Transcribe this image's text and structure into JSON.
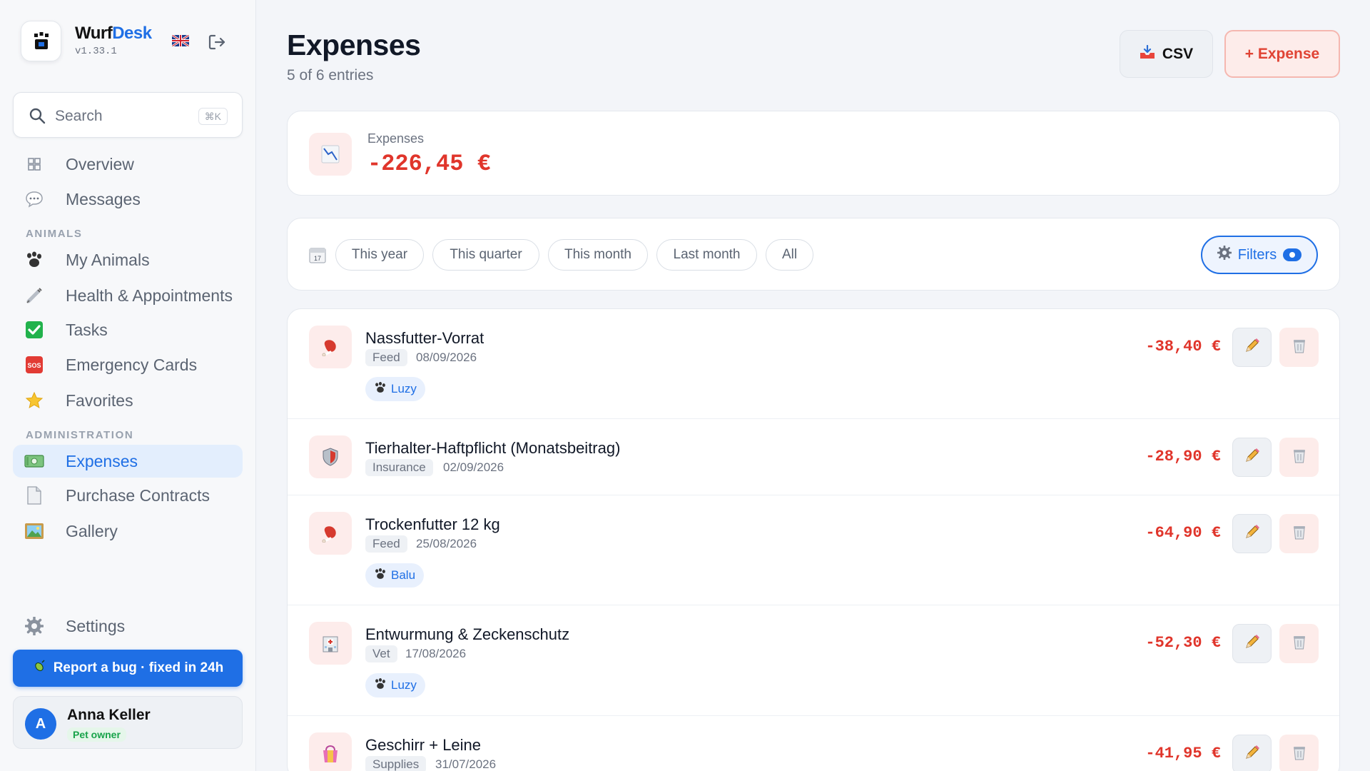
{
  "app": {
    "name_part1": "Wurf",
    "name_part2": "Desk",
    "version": "v1.33.1"
  },
  "search": {
    "label": "Search",
    "shortcut": "⌘K"
  },
  "nav": {
    "overview": "Overview",
    "messages": "Messages",
    "section_animals": "ANIMALS",
    "my_animals": "My Animals",
    "health": "Health & Appointments",
    "tasks": "Tasks",
    "emergency": "Emergency Cards",
    "favorites": "Favorites",
    "section_admin": "ADMINISTRATION",
    "expenses": "Expenses",
    "contracts": "Purchase Contracts",
    "gallery": "Gallery",
    "settings": "Settings"
  },
  "bug_button": "Report a bug · fixed in 24h",
  "user": {
    "initial": "A",
    "name": "Anna Keller",
    "role": "Pet owner"
  },
  "page": {
    "title": "Expenses",
    "subtitle": "5 of 6 entries"
  },
  "actions": {
    "csv": "CSV",
    "add": "+ Expense"
  },
  "summary": {
    "label": "Expenses",
    "value": "-226,45 €"
  },
  "filters": {
    "this_year": "This year",
    "this_quarter": "This quarter",
    "this_month": "This month",
    "last_month": "Last month",
    "all": "All",
    "filters_label": "Filters"
  },
  "rows": [
    {
      "title": "Nassfutter-Vorrat",
      "category": "Feed",
      "date": "08/09/2026",
      "pet": "Luzy",
      "amount": "-38,40 €"
    },
    {
      "title": "Tierhalter-Haftpflicht (Monatsbeitrag)",
      "category": "Insurance",
      "date": "02/09/2026",
      "amount": "-28,90 €"
    },
    {
      "title": "Trockenfutter 12 kg",
      "category": "Feed",
      "date": "25/08/2026",
      "pet": "Balu",
      "amount": "-64,90 €"
    },
    {
      "title": "Entwurmung & Zeckenschutz",
      "category": "Vet",
      "date": "17/08/2026",
      "pet": "Luzy",
      "amount": "-52,30 €"
    },
    {
      "title": "Geschirr + Leine",
      "category": "Supplies",
      "date": "31/07/2026",
      "amount": "-41,95 €"
    }
  ],
  "colors": {
    "accent": "#1f6fe5",
    "negative": "#e0352b",
    "success": "#18a34a"
  },
  "icons": {
    "brand": "paw-logo-icon",
    "flag": "uk-flag-icon",
    "logout": "logout-icon",
    "feed": "meat-icon",
    "insurance": "shield-icon",
    "vet": "hospital-icon",
    "supplies": "shopping-bag-icon"
  }
}
